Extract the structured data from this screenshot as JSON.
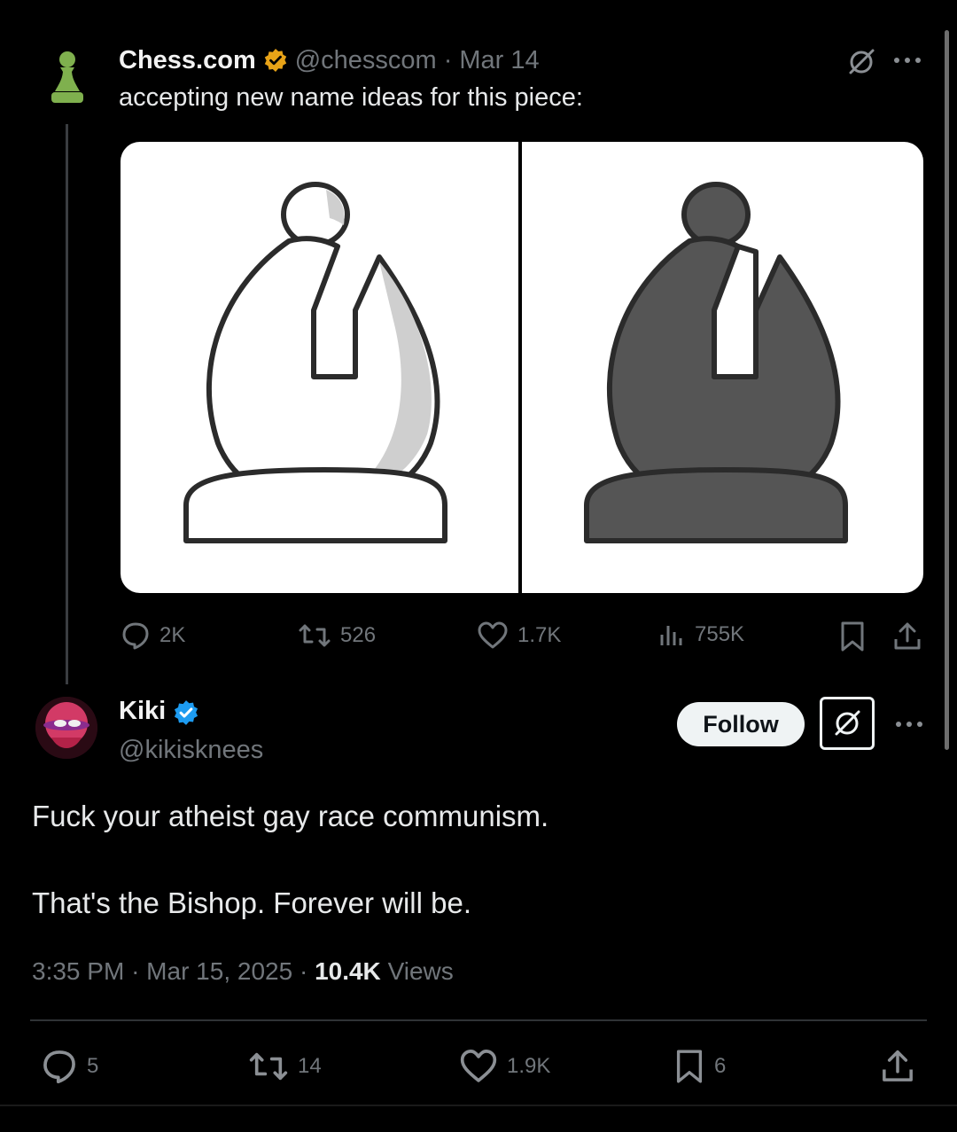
{
  "original_tweet": {
    "display_name": "Chess.com",
    "handle": "@chesscom",
    "separator": "·",
    "date": "Mar 14",
    "text": "accepting new name ideas for this piece:",
    "stats": {
      "replies": "2K",
      "reposts": "526",
      "likes": "1.7K",
      "views": "755K"
    },
    "avatar_icon": "pawn-icon",
    "badge_color": "#e8a317"
  },
  "reply_tweet": {
    "display_name": "Kiki",
    "handle": "@kikisknees",
    "follow_label": "Follow",
    "line1": "Fuck your atheist gay race communism.",
    "line2": "That's the Bishop. Forever will be.",
    "time": "3:35 PM",
    "dot1": "·",
    "date": "Mar 15, 2025",
    "dot2": "·",
    "views_count": "10.4K",
    "views_label": "Views",
    "stats": {
      "replies": "5",
      "reposts": "14",
      "likes": "1.9K",
      "bookmarks": "6"
    },
    "badge_color": "#1d9bf0"
  },
  "colors": {
    "background": "#000000",
    "muted_text": "#71767b",
    "primary_text": "#e7e9ea",
    "pawn_green": "#7fb04e"
  }
}
